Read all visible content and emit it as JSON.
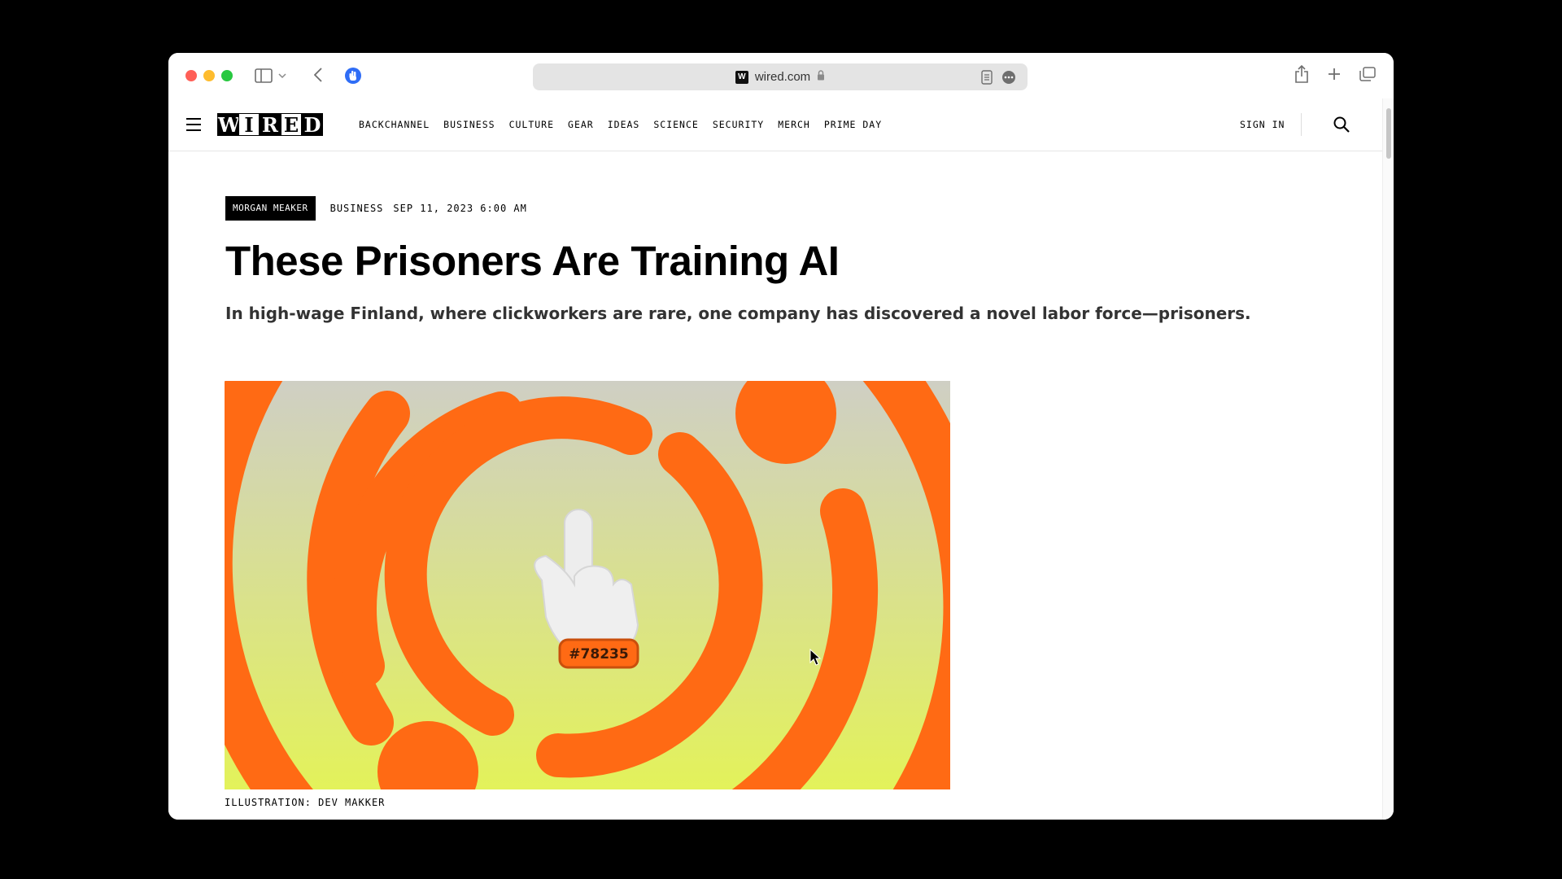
{
  "browser": {
    "url": "wired.com",
    "colors": {
      "close": "#ff5f57",
      "minimize": "#febc2e",
      "zoom": "#28c840"
    }
  },
  "site": {
    "logo_letters": [
      "W",
      "I",
      "R",
      "E",
      "D"
    ],
    "nav": [
      "BACKCHANNEL",
      "BUSINESS",
      "CULTURE",
      "GEAR",
      "IDEAS",
      "SCIENCE",
      "SECURITY",
      "MERCH",
      "PRIME DAY"
    ],
    "sign_in": "SIGN IN"
  },
  "article": {
    "author": "MORGAN MEAKER",
    "category": "BUSINESS",
    "date": "SEP 11, 2023 6:00 AM",
    "headline": "These Prisoners Are Training AI",
    "dek": "In high-wage Finland, where clickworkers are rare, one company has discovered a novel labor force—prisoners.",
    "image_tag": "#78235",
    "caption": "ILLUSTRATION: DEV MAKKER",
    "image_colors": {
      "ring": "#ff6a14",
      "bg_top": "#cfcfc4",
      "bg_bottom": "#e3f25a"
    }
  }
}
